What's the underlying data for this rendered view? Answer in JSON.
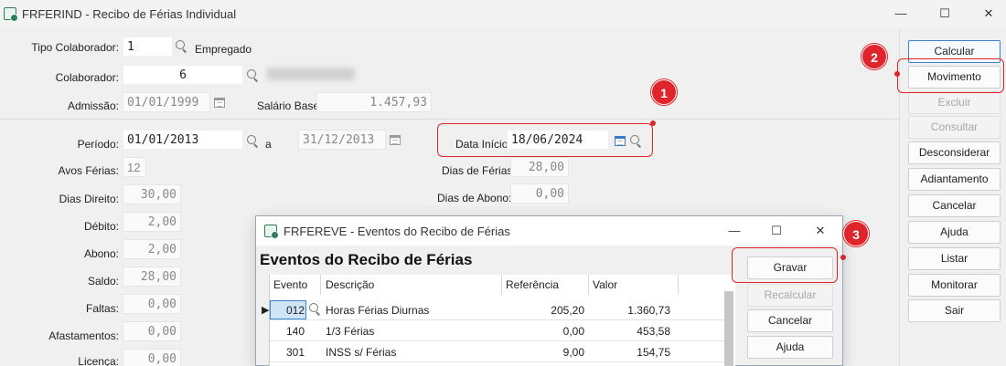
{
  "window": {
    "title": "FRFERIND - Recibo de Férias Individual",
    "controls": {
      "minimize": "—",
      "maximize": "☐",
      "close": "✕"
    }
  },
  "form": {
    "tipo_colaborador": {
      "label": "Tipo Colaborador:",
      "value": "1",
      "description": "Empregado"
    },
    "colaborador": {
      "label": "Colaborador:",
      "value": "6"
    },
    "admissao": {
      "label": "Admissão:",
      "value": "01/01/1999"
    },
    "salario_base": {
      "label": "Salário Base:",
      "value": "1.457,93"
    },
    "periodo": {
      "label": "Período:",
      "start": "01/01/2013",
      "separator": "a",
      "end": "31/12/2013"
    },
    "data_inicio": {
      "label": "Data Início:",
      "value": "18/06/2024"
    },
    "avos_ferias": {
      "label": "Avos Férias:",
      "value": "12"
    },
    "dias_ferias": {
      "label": "Dias de Férias:",
      "value": "28,00"
    },
    "dias_direito": {
      "label": "Dias Direito:",
      "value": "30,00"
    },
    "dias_abono": {
      "label": "Dias de Abono:",
      "value": "0,00"
    },
    "debito": {
      "label": "Débito:",
      "value": "2,00"
    },
    "abono": {
      "label": "Abono:",
      "value": "2,00"
    },
    "saldo": {
      "label": "Saldo:",
      "value": "28,00"
    },
    "faltas": {
      "label": "Faltas:",
      "value": "0,00"
    },
    "afastamentos": {
      "label": "Afastamentos:",
      "value": "0,00"
    },
    "licenca": {
      "label": "Licença:",
      "value": "0,00"
    }
  },
  "sidebar": {
    "buttons": [
      "Calcular",
      "Movimento",
      "Excluir",
      "Consultar",
      "Desconsiderar",
      "Adiantamento",
      "Cancelar",
      "Ajuda",
      "Listar",
      "Monitorar",
      "Sair"
    ]
  },
  "callouts": [
    "1",
    "2",
    "3"
  ],
  "dialog": {
    "title": "FRFEREVE - Eventos do Recibo de Férias",
    "heading": "Eventos do Recibo de Férias",
    "columns": [
      "Evento",
      "Descrição",
      "Referência",
      "Valor"
    ],
    "rows": [
      {
        "evento": "012",
        "descricao": "Horas Férias Diurnas",
        "referencia": "205,20",
        "valor": "1.360,73"
      },
      {
        "evento": "140",
        "descricao": "1/3 Férias",
        "referencia": "0,00",
        "valor": "453,58"
      },
      {
        "evento": "301",
        "descricao": "INSS s/ Férias",
        "referencia": "9,00",
        "valor": "154,75"
      }
    ],
    "buttons": [
      "Gravar",
      "Recalcular",
      "Cancelar",
      "Ajuda"
    ]
  },
  "colors": {
    "callout": "#e0242b",
    "focus": "#3b82d0",
    "selected_cell": "#cfe4f7"
  }
}
